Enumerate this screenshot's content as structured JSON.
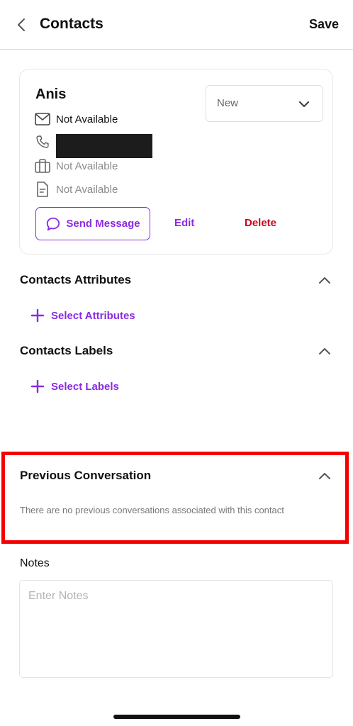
{
  "header": {
    "title": "Contacts",
    "save_label": "Save"
  },
  "contact": {
    "name": "Anis",
    "status_value": "New",
    "email": "Not Available",
    "company": "Not Available",
    "notes_field": "Not Available",
    "actions": {
      "send_message": "Send Message",
      "edit": "Edit",
      "delete": "Delete"
    }
  },
  "sections": {
    "attributes": {
      "title": "Contacts Attributes",
      "add_label": "Select Attributes"
    },
    "labels": {
      "title": "Contacts Labels",
      "add_label": "Select Labels"
    },
    "previous_conversation": {
      "title": "Previous Conversation",
      "empty_text": "There are no previous conversations associated with this contact"
    }
  },
  "notes": {
    "label": "Notes",
    "placeholder": "Enter Notes"
  },
  "colors": {
    "accent": "#8a2be2",
    "danger": "#d0021b",
    "highlight": "#f50000"
  }
}
